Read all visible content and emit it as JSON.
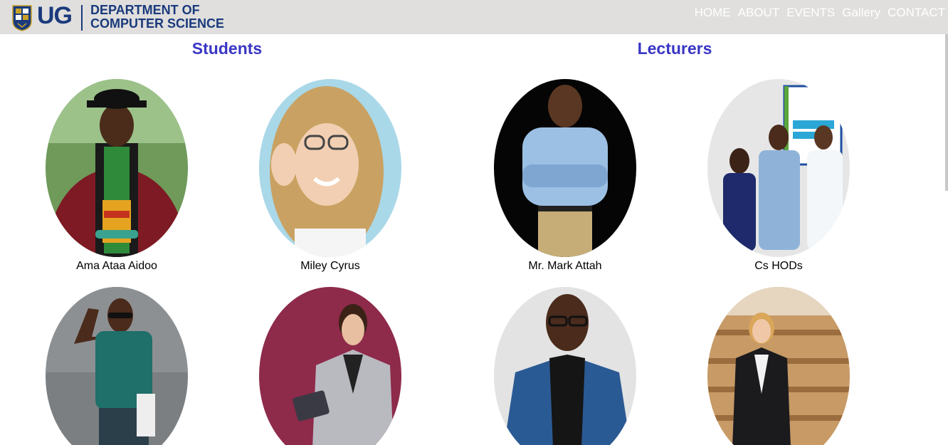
{
  "header": {
    "logo_text": "UG",
    "department_line1": "DEPARTMENT OF",
    "department_line2": "COMPUTER SCIENCE",
    "nav": [
      "HOME",
      "ABOUT",
      "EVENTS",
      "Gallery",
      "CONTACT"
    ],
    "background": "#e0dfdd",
    "brand_color": "#1a3a7c"
  },
  "sections": {
    "students_title": "Students",
    "lecturers_title": "Lecturers",
    "title_color": "#3a36c4"
  },
  "students": [
    {
      "name": "Ama Ataa Aidoo",
      "photo": "graduate-portrait"
    },
    {
      "name": "Miley Cyrus",
      "photo": "woman-glasses-portrait"
    },
    {
      "name": "",
      "photo": "man-glasses-portrait"
    },
    {
      "name": "",
      "photo": "woman-tablet-portrait"
    }
  ],
  "lecturers": [
    {
      "name": "Mr. Mark Attah",
      "photo": "man-blue-shirt-portrait"
    },
    {
      "name": "Cs HODs",
      "photo": "group-photo"
    },
    {
      "name": "",
      "photo": "man-turtleneck-portrait"
    },
    {
      "name": "",
      "photo": "woman-lecture-hall-portrait"
    }
  ]
}
